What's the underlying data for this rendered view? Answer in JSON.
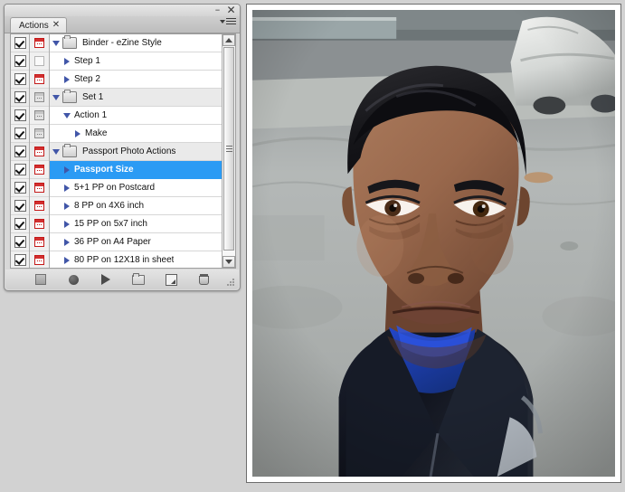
{
  "panel": {
    "tab_label": "Actions",
    "tab_close_icon": "close-icon",
    "minimize_icon": "minimize-icon",
    "close_icon": "close-icon",
    "menu_icon": "panel-menu-icon",
    "colors": {
      "selection": "#2b9bf4",
      "dialog_on": "#c41818",
      "triangle": "#4156a8",
      "panel_bg": "#d8d8d8",
      "desktop_bg": "#d2d2d2"
    }
  },
  "rows": [
    {
      "label": "Binder - eZine Style",
      "indent": 0,
      "type": "set",
      "triangle": "open",
      "checked": true,
      "dialog": "red",
      "selected": false,
      "alt": false
    },
    {
      "label": "Step 1",
      "indent": 1,
      "type": "action",
      "triangle": "closed",
      "checked": true,
      "dialog": "empty",
      "selected": false,
      "alt": false
    },
    {
      "label": "Step 2",
      "indent": 1,
      "type": "action",
      "triangle": "closed",
      "checked": true,
      "dialog": "red",
      "selected": false,
      "alt": false
    },
    {
      "label": "Set 1",
      "indent": 0,
      "type": "set",
      "triangle": "open",
      "checked": true,
      "dialog": "gray",
      "selected": false,
      "alt": true
    },
    {
      "label": "Action 1",
      "indent": 1,
      "type": "action",
      "triangle": "open",
      "checked": true,
      "dialog": "gray",
      "selected": false,
      "alt": false
    },
    {
      "label": "Make",
      "indent": 2,
      "type": "step",
      "triangle": "closed",
      "checked": true,
      "dialog": "gray",
      "selected": false,
      "alt": false
    },
    {
      "label": "Passport Photo Actions",
      "indent": 0,
      "type": "set",
      "triangle": "open",
      "checked": true,
      "dialog": "red",
      "selected": false,
      "alt": true
    },
    {
      "label": "Passport Size",
      "indent": 1,
      "type": "action",
      "triangle": "closed",
      "checked": true,
      "dialog": "red",
      "selected": true,
      "alt": false
    },
    {
      "label": "5+1 PP on Postcard",
      "indent": 1,
      "type": "action",
      "triangle": "closed",
      "checked": true,
      "dialog": "red",
      "selected": false,
      "alt": false
    },
    {
      "label": "8 PP on 4X6 inch",
      "indent": 1,
      "type": "action",
      "triangle": "closed",
      "checked": true,
      "dialog": "red",
      "selected": false,
      "alt": false
    },
    {
      "label": "15 PP on 5x7 inch",
      "indent": 1,
      "type": "action",
      "triangle": "closed",
      "checked": true,
      "dialog": "red",
      "selected": false,
      "alt": false
    },
    {
      "label": "36 PP on A4 Paper",
      "indent": 1,
      "type": "action",
      "triangle": "closed",
      "checked": true,
      "dialog": "red",
      "selected": false,
      "alt": false
    },
    {
      "label": "80 PP on 12X18 in sheet",
      "indent": 1,
      "type": "action",
      "triangle": "closed",
      "checked": true,
      "dialog": "red",
      "selected": false,
      "alt": false
    }
  ],
  "toolbar": [
    {
      "name": "stop-playing-recording-button",
      "icon": "stop-icon"
    },
    {
      "name": "begin-recording-button",
      "icon": "record-icon"
    },
    {
      "name": "play-selection-button",
      "icon": "play-icon"
    },
    {
      "name": "create-new-set-button",
      "icon": "new-folder-icon"
    },
    {
      "name": "create-new-action-button",
      "icon": "new-page-icon"
    },
    {
      "name": "delete-button",
      "icon": "trash-icon"
    }
  ],
  "scrollbar": {
    "up_icon": "scroll-up-arrow-icon",
    "down_icon": "scroll-down-arrow-icon",
    "grip_icon": "scrollbar-grip-icon"
  },
  "photo": {
    "description": "Passport-style portrait photograph of a man with short dark hair wearing a dark navy zip jacket over a royal blue collared shirt, photographed outdoors on a paved street with a white tarp-covered vehicle behind him."
  }
}
